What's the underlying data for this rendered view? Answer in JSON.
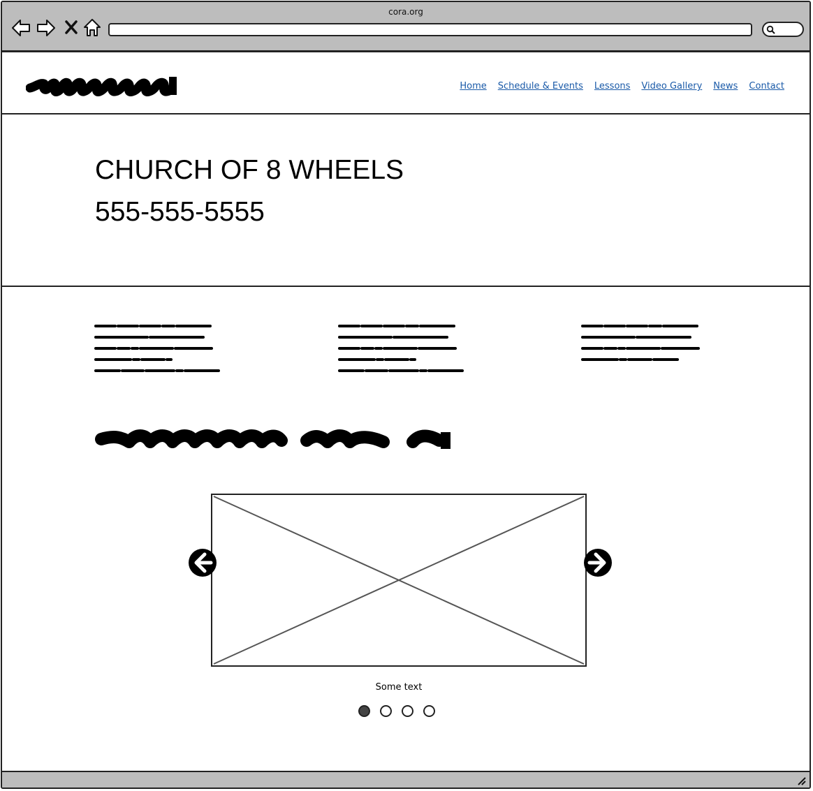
{
  "browser": {
    "url": "cora.org",
    "icons": [
      "back-icon",
      "forward-icon",
      "close-icon",
      "home-icon",
      "search-icon"
    ]
  },
  "header": {
    "nav": [
      "Home",
      "Schedule & Events",
      "Lessons",
      "Video Gallery",
      "News",
      "Contact"
    ],
    "link_color": "#1a5aa8"
  },
  "hero": {
    "title": "CHURCH OF 8 WHEELS",
    "phone": "555-555-5555"
  },
  "carousel": {
    "caption": "Some text",
    "slide_count": 4,
    "active_slide": 1
  }
}
